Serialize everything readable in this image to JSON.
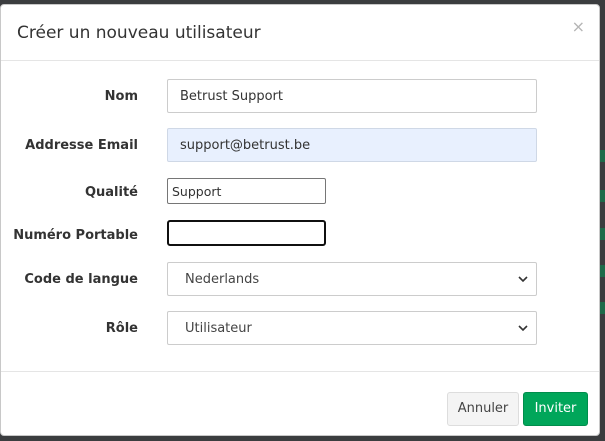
{
  "modal": {
    "title": "Créer un nouveau utilisateur",
    "close_symbol": "×"
  },
  "form": {
    "name": {
      "label": "Nom",
      "value": "Betrust Support"
    },
    "email": {
      "label": "Addresse Email",
      "value": "support@betrust.be"
    },
    "quality": {
      "label": "Qualité",
      "value": "Support"
    },
    "mobile": {
      "label": "Numéro Portable",
      "value": ""
    },
    "language": {
      "label": "Code de langue",
      "selected": "Nederlands"
    },
    "role": {
      "label": "Rôle",
      "selected": "Utilisateur"
    }
  },
  "footer": {
    "cancel_label": "Annuler",
    "invite_label": "Inviter"
  },
  "colors": {
    "invite_button": "#00a65a",
    "autofill_background": "#e8f0fe"
  },
  "icons": {
    "close": "close-icon",
    "dropdown": "chevron-down-icon"
  }
}
